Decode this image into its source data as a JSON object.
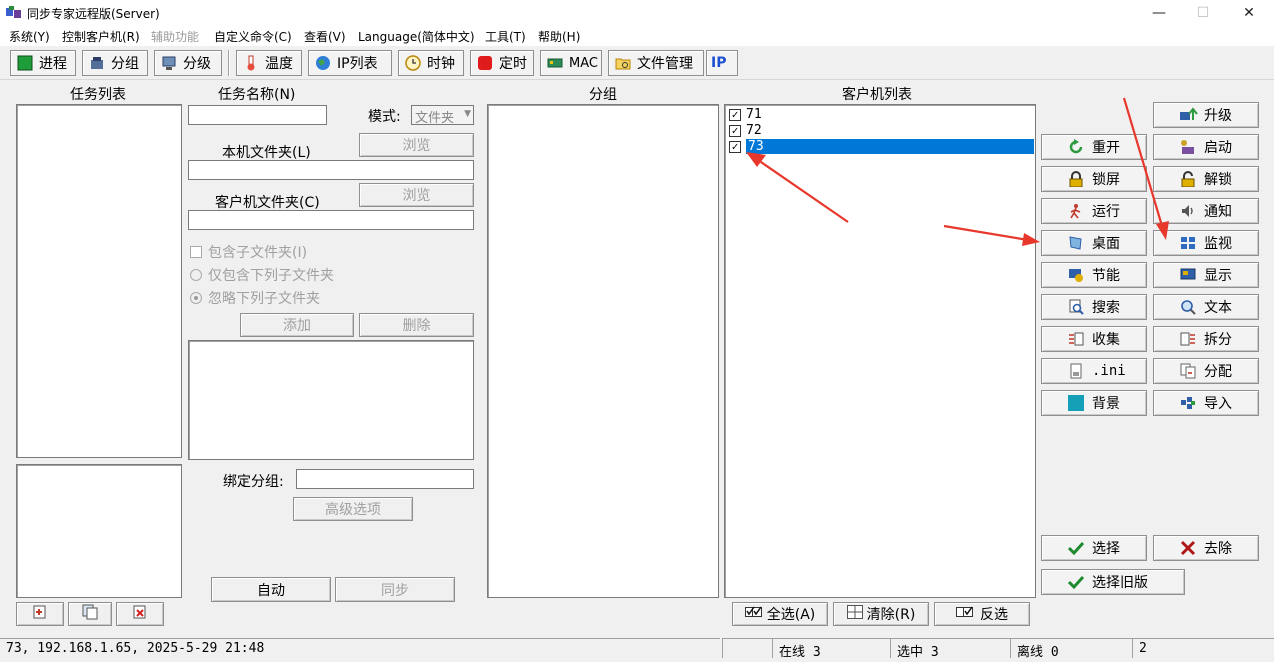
{
  "window": {
    "title": "同步专家远程版(Server)",
    "min": "—",
    "max": "☐",
    "close": "✕"
  },
  "menu": [
    "系统(Y)",
    "控制客户机(R)",
    "辅助功能",
    "自定义命令(C)",
    "查看(V)",
    "Language(简体中文)",
    "工具(T)",
    "帮助(H)"
  ],
  "toolbar": [
    "进程",
    "分组",
    "分级",
    "温度",
    "IP列表",
    "时钟",
    "定时",
    "MAC",
    "文件管理",
    "IP"
  ],
  "task": {
    "list_header": "任务列表",
    "name_label": "任务名称(N)",
    "mode_label": "模式:",
    "mode_value": "文件夹",
    "local_folder_label": "本机文件夹(L)",
    "client_folder_label": "客户机文件夹(C)",
    "browse": "浏览",
    "include_sub": "包含子文件夹(I)",
    "only_include": "仅包含下列子文件夹",
    "ignore": "忽略下列子文件夹",
    "add": "添加",
    "delete": "删除",
    "bind_group_label": "绑定分组:",
    "advanced": "高级选项",
    "auto": "自动",
    "sync": "同步"
  },
  "group": {
    "header": "分组"
  },
  "clients": {
    "header": "客户机列表",
    "items": [
      {
        "label": "71",
        "checked": true
      },
      {
        "label": "72",
        "checked": true
      },
      {
        "label": "73",
        "checked": true
      }
    ],
    "select_all": "全选(A)",
    "clear": "清除(R)",
    "invert": "反选"
  },
  "actions": {
    "upgrade": "升级",
    "restart": "重开",
    "start": "启动",
    "lock": "锁屏",
    "unlock": "解锁",
    "run": "运行",
    "notify": "通知",
    "desktop": "桌面",
    "monitor": "监视",
    "power": "节能",
    "display": "显示",
    "search": "搜索",
    "text": "文本",
    "collect": "收集",
    "split": "拆分",
    "ini": ".ini",
    "assign": "分配",
    "background": "背景",
    "import": "导入",
    "select": "选择",
    "remove": "去除",
    "select_old": "选择旧版"
  },
  "status": {
    "info": "73, 192.168.1.65, 2025-5-29 21:48",
    "online": "在线 3",
    "selected": "选中 3",
    "offline": "离线 0",
    "count": "2"
  },
  "colors": {
    "selection": "#0078d7",
    "arrow": "#e8382c"
  }
}
